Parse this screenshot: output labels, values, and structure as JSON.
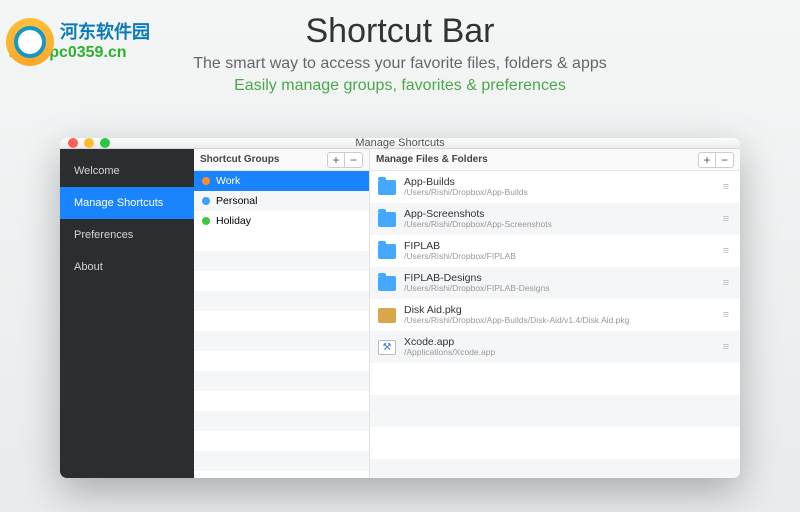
{
  "watermark": {
    "text": "河东软件园",
    "url": "www.pc0359.cn"
  },
  "hero": {
    "title": "Shortcut Bar",
    "subtitle": "The smart way to access your favorite files, folders & apps",
    "tagline": "Easily manage groups, favorites & preferences"
  },
  "window": {
    "title": "Manage Shortcuts"
  },
  "sidebar": {
    "items": [
      {
        "label": "Welcome",
        "active": false
      },
      {
        "label": "Manage Shortcuts",
        "active": true
      },
      {
        "label": "Preferences",
        "active": false
      },
      {
        "label": "About",
        "active": false
      }
    ]
  },
  "groups": {
    "header": "Shortcut Groups",
    "add": "+",
    "remove": "−",
    "items": [
      {
        "label": "Work",
        "color": "orange",
        "selected": true
      },
      {
        "label": "Personal",
        "color": "blue",
        "selected": false
      },
      {
        "label": "Holiday",
        "color": "green",
        "selected": false
      }
    ]
  },
  "files": {
    "header": "Manage Files & Folders",
    "add": "+",
    "remove": "−",
    "items": [
      {
        "name": "App-Builds",
        "path": "/Users/Rishi/Dropbox/App-Builds",
        "kind": "folder"
      },
      {
        "name": "App-Screenshots",
        "path": "/Users/Rishi/Dropbox/App-Screenshots",
        "kind": "folder"
      },
      {
        "name": "FIPLAB",
        "path": "/Users/Rishi/Dropbox/FIPLAB",
        "kind": "folder"
      },
      {
        "name": "FIPLAB-Designs",
        "path": "/Users/Rishi/Dropbox/FIPLAB-Designs",
        "kind": "folder"
      },
      {
        "name": "Disk Aid.pkg",
        "path": "/Users/Rishi/Dropbox/App-Builds/Disk-Aid/v1.4/Disk Aid.pkg",
        "kind": "pkg"
      },
      {
        "name": "Xcode.app",
        "path": "/Applications/Xcode.app",
        "kind": "app"
      }
    ]
  }
}
